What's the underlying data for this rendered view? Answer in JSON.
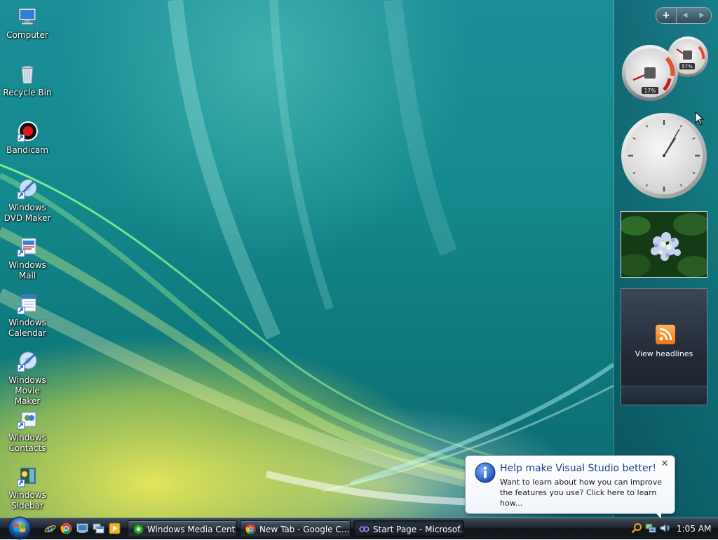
{
  "desktop": {
    "icons": [
      {
        "label": "Computer",
        "icon": "computer-icon"
      },
      {
        "label": "Recycle Bin",
        "icon": "recycle-bin-icon"
      },
      {
        "label": "Bandicam",
        "icon": "bandicam-icon"
      },
      {
        "label": "Windows DVD Maker",
        "icon": "dvd-maker-icon"
      },
      {
        "label": "Windows Mail",
        "icon": "mail-icon"
      },
      {
        "label": "Windows Calendar",
        "icon": "calendar-icon"
      },
      {
        "label": "Windows Movie Maker",
        "icon": "movie-maker-icon"
      },
      {
        "label": "Windows Contacts",
        "icon": "contacts-icon"
      },
      {
        "label": "Windows Sidebar",
        "icon": "sidebar-icon"
      }
    ]
  },
  "sidebar": {
    "add_label": "+",
    "prev_label": "◀",
    "next_label": "▶",
    "cpu_meter": {
      "cpu_percent": "17%",
      "memory_percent": "57%"
    },
    "clock": {
      "hour": 1,
      "minute": 5
    },
    "feed_headlines": {
      "label": "View headlines"
    }
  },
  "notification": {
    "title": "Help make Visual Studio better!",
    "body": "Want to learn about how you can improve the features you use? Click here to learn how...",
    "close_label": "✕"
  },
  "taskbar": {
    "quick_launch": [
      "internet-explorer-icon",
      "chrome-icon",
      "show-desktop-icon",
      "switch-windows-icon",
      "media-player-icon"
    ],
    "tasks": [
      {
        "label": "Windows Media Cent...",
        "icon": "media-center-icon",
        "active": false
      },
      {
        "label": "New Tab - Google C...",
        "icon": "chrome-icon",
        "active": false
      },
      {
        "label": "Start Page - Microsof...",
        "icon": "visual-studio-icon",
        "active": true
      }
    ],
    "tray_icons": [
      "search-icon",
      "network-icon",
      "volume-icon"
    ],
    "clock": "1:05 AM"
  },
  "colors": {
    "wallpaper_teal": "#158a8e",
    "wallpaper_yellow": "#e4e85a",
    "balloon_title": "#1e3c8c",
    "taskbar": "#141b21"
  }
}
